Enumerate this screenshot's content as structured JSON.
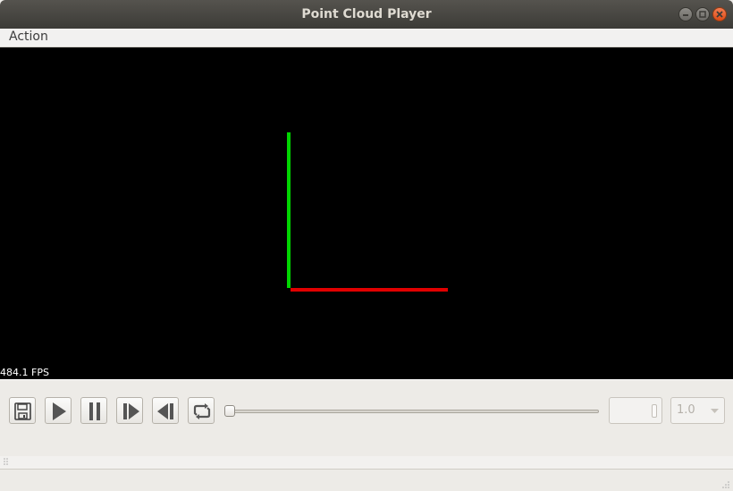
{
  "window": {
    "title": "Point Cloud Player",
    "controls": [
      "minimize-icon",
      "maximize-icon",
      "close-icon"
    ]
  },
  "menubar": {
    "items": [
      {
        "label": "Action"
      }
    ]
  },
  "viewport": {
    "background": "#000000",
    "fps_text": "484.1 FPS",
    "axes": {
      "x_color": "#e10000",
      "y_color": "#00d400"
    }
  },
  "controls": {
    "buttons": [
      {
        "name": "save-button",
        "icon": "floppy-disk-icon"
      },
      {
        "name": "play-button",
        "icon": "play-icon"
      },
      {
        "name": "pause-button",
        "icon": "pause-icon"
      },
      {
        "name": "step-forward-button",
        "icon": "step-forward-icon"
      },
      {
        "name": "step-backward-button",
        "icon": "step-backward-icon"
      },
      {
        "name": "loop-button",
        "icon": "loop-icon"
      }
    ],
    "timeline": {
      "position_fraction": 0.0
    },
    "frame_spinbox": {
      "value": ""
    },
    "speed_combo": {
      "value": "1.0"
    }
  }
}
